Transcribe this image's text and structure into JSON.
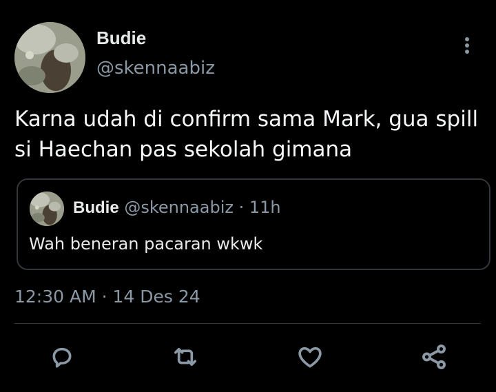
{
  "tweet": {
    "author_name": "Budie",
    "author_handle": "@skennaabiz",
    "text": "Karna udah di confirm sama Mark, gua spill\nsi Haechan pas sekolah gimana",
    "timestamp": "12:30 AM · 14 Des 24"
  },
  "quote": {
    "author_name": "Budie",
    "meta": "@skennaabiz · 11h",
    "text": "Wah beneran pacaran wkwk"
  },
  "icons": {
    "more": "more-vertical-icon",
    "reply": "reply-icon",
    "retweet": "retweet-icon",
    "like": "heart-icon",
    "share": "share-icon"
  },
  "colors": {
    "background": "#000000",
    "text": "#e7e9ea",
    "secondary": "#8b98a5",
    "border": "#333639"
  }
}
